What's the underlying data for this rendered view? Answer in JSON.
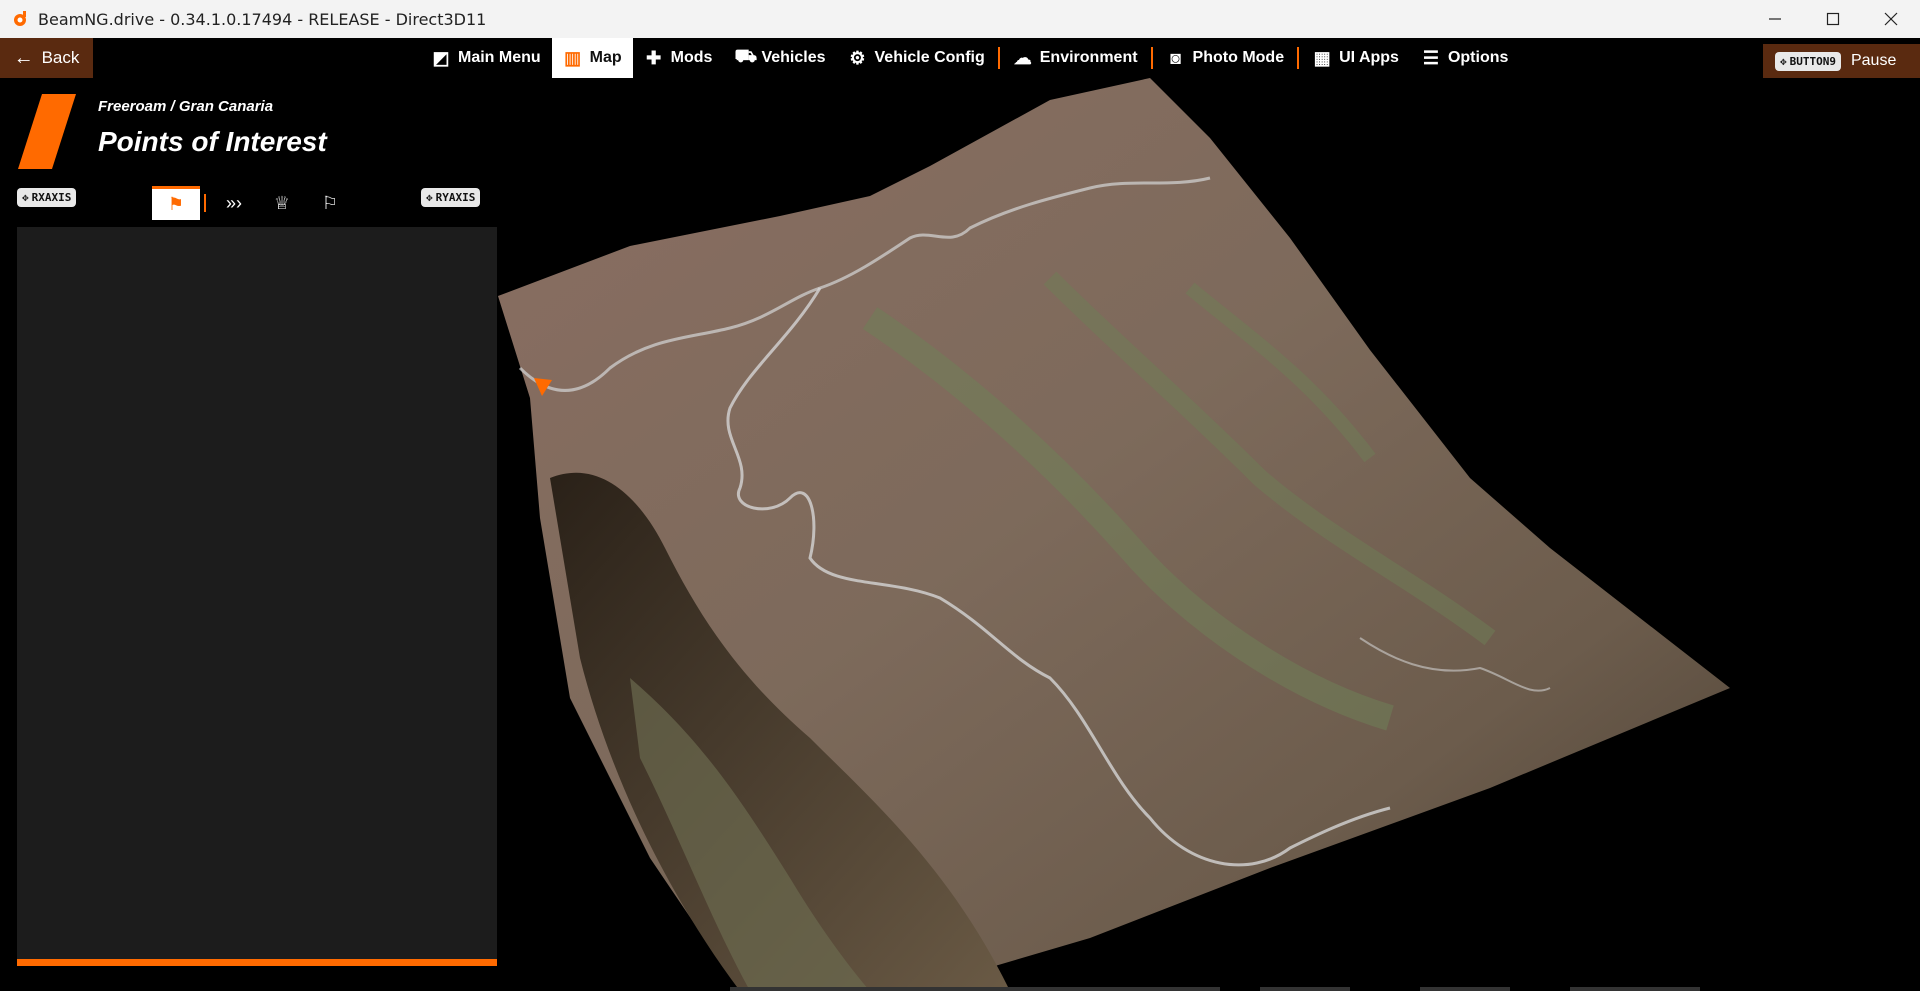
{
  "window": {
    "title": "BeamNG.drive - 0.34.1.0.17494 - RELEASE - Direct3D11",
    "controls": [
      "minimize",
      "maximize",
      "close"
    ]
  },
  "menubar": {
    "back_label": "Back",
    "items": [
      {
        "label": "Main Menu",
        "icon": "main-menu-icon"
      },
      {
        "label": "Map",
        "icon": "map-icon",
        "active": true
      },
      {
        "label": "Mods",
        "icon": "puzzle-icon"
      },
      {
        "label": "Vehicles",
        "icon": "car-icon"
      },
      {
        "label": "Vehicle Config",
        "icon": "engine-icon"
      },
      {
        "label": "Environment",
        "icon": "weather-icon"
      },
      {
        "label": "Photo Mode",
        "icon": "camera-icon"
      },
      {
        "label": "UI Apps",
        "icon": "ui-apps-icon"
      },
      {
        "label": "Options",
        "icon": "sliders-icon"
      }
    ],
    "pause_button_chip": "BUTTON9",
    "pause_label": "Pause"
  },
  "header": {
    "breadcrumb": "Freeroam / Gran Canaria",
    "title": "Points of Interest"
  },
  "panel": {
    "left_chip": "RXAXIS",
    "right_chip": "RYAXIS",
    "tabs": [
      {
        "icon": "poi-flag-icon",
        "active": true
      },
      {
        "icon": "chevrons-icon"
      },
      {
        "icon": "trophy-icon"
      },
      {
        "icon": "add-flag-icon"
      }
    ]
  },
  "colors": {
    "accent": "#ff6a00",
    "back_bg": "#5a2a10",
    "panel_bg": "#1c1c1c"
  }
}
